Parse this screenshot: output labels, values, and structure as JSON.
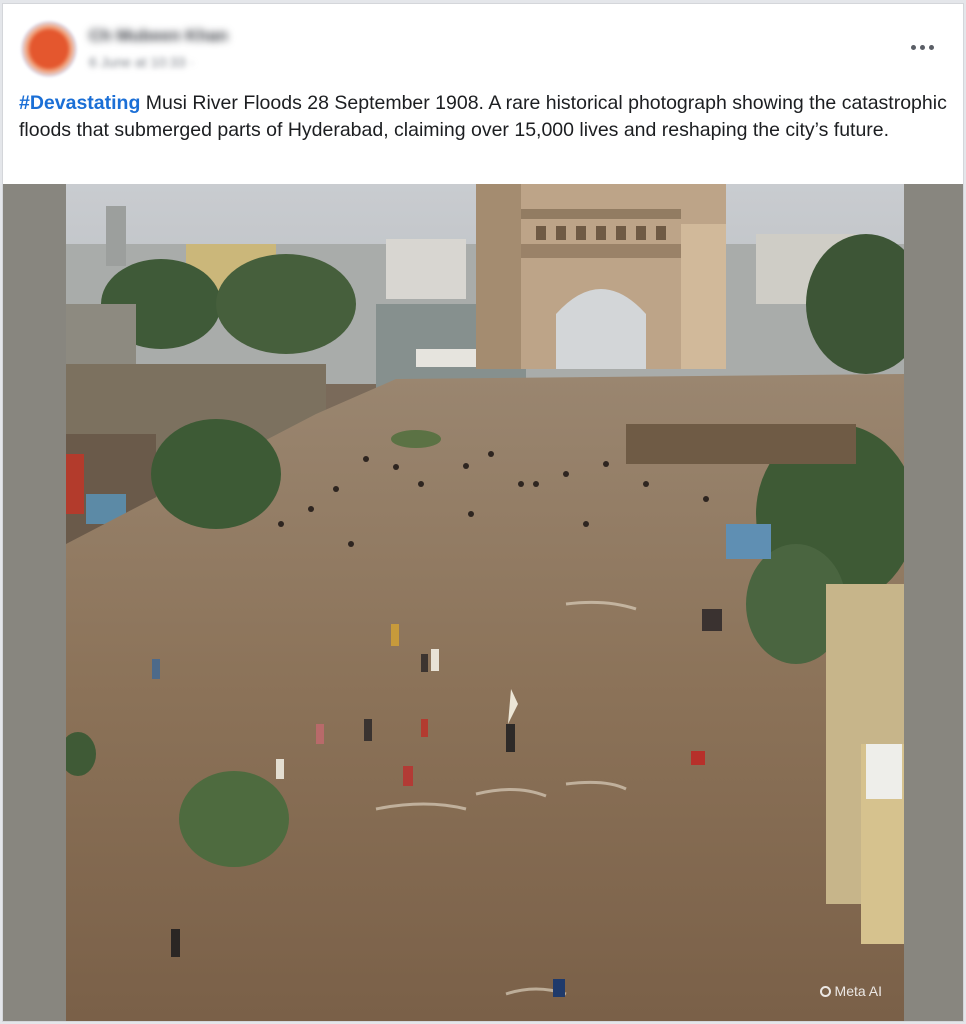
{
  "post": {
    "author_name": "Ch Mubeen Khan",
    "meta": "6 June at 10:33 · ",
    "more_label": "•••",
    "caption": {
      "hashtag": "#Devastating",
      "text": " Musi River Floods 28 September 1908. A rare historical photograph showing the catastrophic floods that submerged parts of Hyderabad, claiming over 15,000 lives and reshaping the city’s future."
    },
    "image": {
      "alt": "Flooded street in front of Charminar-like monument with people wading through brown water",
      "watermark": "Meta AI"
    }
  },
  "colors": {
    "hashtag": "#1b6fd6",
    "text": "#1c1e21",
    "water": "#8a7257"
  }
}
